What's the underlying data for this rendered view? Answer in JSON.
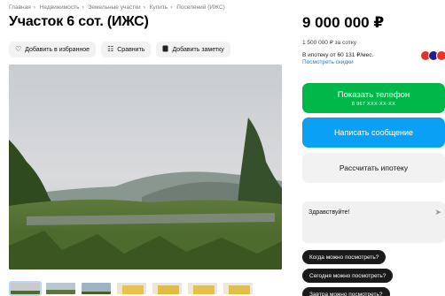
{
  "breadcrumb": [
    "Главная",
    "Недвижимость",
    "Земельные участки",
    "Купить",
    "Поселений (ИЖС)"
  ],
  "title": "Участок 6 сот. (ИЖС)",
  "actions": {
    "favorite": "Добавить в избранное",
    "compare": "Сравнить",
    "note": "Добавить заметку"
  },
  "price": "9 000 000 ₽",
  "price_per": "1 500 000 ₽ за сотку",
  "mortgage": "В ипотеку от 60 131 ₽/мес.",
  "mortgage_link": "Посмотреть скидки",
  "phone_button": {
    "label": "Показать телефон",
    "masked": "8 967 XXX-XX-XX"
  },
  "message_button": "Написать сообщение",
  "calc_button": "Рассчитать ипотеку",
  "chat": {
    "greeting": "Здравствуйте!"
  },
  "quick_questions": [
    "Когда можно посмотреть?",
    "Сегодня можно посмотреть?",
    "Завтра можно посмотреть?"
  ],
  "bank_colors": [
    "#e4312b",
    "#1f1f8f",
    "#ef3124"
  ],
  "accent_colors": {
    "phone": "#00b84a",
    "message": "#0aa0f5"
  }
}
